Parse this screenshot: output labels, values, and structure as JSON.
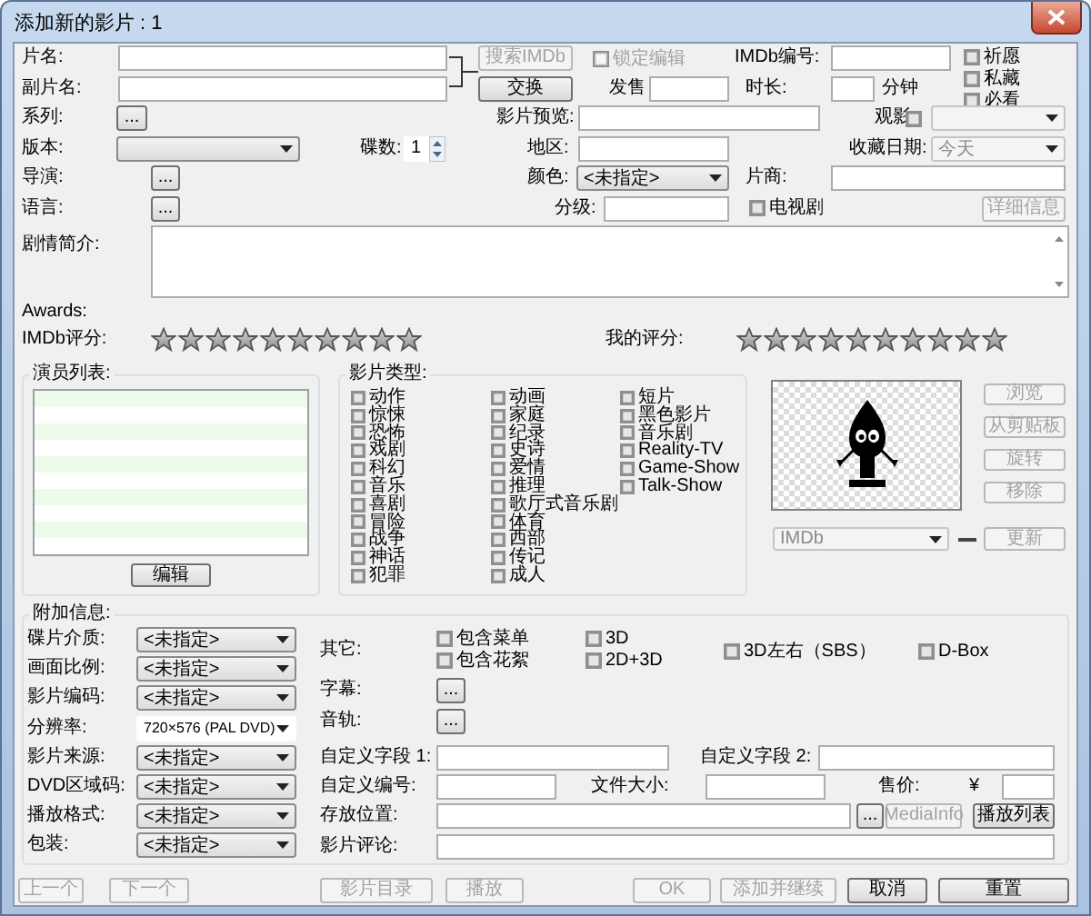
{
  "window": {
    "title": "添加新的影片 : 1"
  },
  "top_rows": [
    [
      {
        "kind": "label",
        "text": "片名:"
      },
      {
        "kind": "field"
      },
      {
        "kind": "button",
        "text": "搜索IMDb",
        "disabled": true
      },
      {
        "kind": "checkbox",
        "text": "锁定编辑",
        "checked": false,
        "disabled": true
      },
      {
        "kind": "label",
        "text": "IMDb编号:"
      },
      {
        "kind": "field"
      },
      {
        "kind": "stack",
        "items": [
          {
            "text": "祈愿",
            "checked": false,
            "disabled": false
          },
          {
            "text": "私藏",
            "checked": false,
            "disabled": false
          },
          {
            "text": "必看",
            "checked": false,
            "disabled": false
          }
        ]
      }
    ],
    [
      {
        "kind": "label",
        "text": "副片名:"
      },
      {
        "kind": "field"
      },
      {
        "kind": "button",
        "text": "交换",
        "disabled": false
      },
      {
        "kind": "label",
        "text": "发售"
      },
      {
        "kind": "field"
      },
      {
        "kind": "label",
        "text": "时长:"
      },
      {
        "kind": "field"
      },
      {
        "kind": "label",
        "text": "分钟"
      }
    ],
    [
      {
        "kind": "label",
        "text": "系列:"
      },
      {
        "kind": "button",
        "text": "...",
        "disabled": false
      },
      {
        "kind": "label",
        "text": "影片预览:"
      },
      {
        "kind": "field"
      },
      {
        "kind": "label",
        "text": "观影"
      },
      {
        "kind": "checkbox",
        "checked": false,
        "disabled": false
      },
      {
        "kind": "dropdown",
        "disabled": true
      }
    ],
    [
      {
        "kind": "label",
        "text": "版本:"
      },
      {
        "kind": "dropdown",
        "disabled": false
      },
      {
        "kind": "label",
        "text": "碟数:"
      },
      {
        "kind": "spin",
        "value": "1"
      },
      {
        "kind": "label",
        "text": "地区:"
      },
      {
        "kind": "field"
      },
      {
        "kind": "label",
        "text": "收藏日期:"
      },
      {
        "kind": "dropdown",
        "value": "今天",
        "disabled": true
      }
    ],
    [
      {
        "kind": "label",
        "text": "导演:"
      },
      {
        "kind": "button",
        "text": "...",
        "disabled": false
      },
      {
        "kind": "label",
        "text": "颜色:"
      },
      {
        "kind": "dropdown",
        "value": "<未指定>",
        "disabled": false
      },
      {
        "kind": "label",
        "text": "片商:"
      },
      {
        "kind": "field"
      }
    ],
    [
      {
        "kind": "label",
        "text": "语言:"
      },
      {
        "kind": "button",
        "text": "...",
        "disabled": false
      },
      {
        "kind": "label",
        "text": "分级:"
      },
      {
        "kind": "field"
      },
      {
        "kind": "checkbox",
        "text": "电视剧",
        "checked": false,
        "disabled": false
      },
      {
        "kind": "button",
        "text": "详细信息",
        "disabled": true
      }
    ]
  ],
  "synopsis": {
    "label": "剧情简介:"
  },
  "awards_label": "Awards:",
  "rating_row": [
    {
      "kind": "label",
      "text": "IMDb评分:"
    },
    {
      "kind": "stars",
      "stars": 0
    },
    {
      "kind": "label",
      "text": "我的评分:"
    },
    {
      "kind": "stars",
      "stars": 0
    }
  ],
  "cast": {
    "title": "演员列表:",
    "button": {
      "text": "编辑",
      "disabled": false
    }
  },
  "genres": {
    "title": "影片类型:",
    "columns": [
      [
        {
          "text": "动作",
          "checked": false
        },
        {
          "text": "惊悚",
          "checked": false
        },
        {
          "text": "恐怖",
          "checked": false
        },
        {
          "text": "戏剧",
          "checked": false
        },
        {
          "text": "科幻",
          "checked": false
        },
        {
          "text": "音乐",
          "checked": false
        },
        {
          "text": "喜剧",
          "checked": false
        },
        {
          "text": "冒险",
          "checked": false
        },
        {
          "text": "战争",
          "checked": false
        },
        {
          "text": "神话",
          "checked": false
        },
        {
          "text": "犯罪",
          "checked": false
        }
      ],
      [
        {
          "text": "动画",
          "checked": false
        },
        {
          "text": "家庭",
          "checked": false
        },
        {
          "text": "纪录",
          "checked": false
        },
        {
          "text": "史诗",
          "checked": false
        },
        {
          "text": "爱情",
          "checked": false
        },
        {
          "text": "推理",
          "checked": false
        },
        {
          "text": "歌厅式音乐剧",
          "checked": false
        },
        {
          "text": "体育",
          "checked": false
        },
        {
          "text": "西部",
          "checked": false
        },
        {
          "text": "传记",
          "checked": false
        },
        {
          "text": "成人",
          "checked": false
        }
      ],
      [
        {
          "text": "短片",
          "checked": false
        },
        {
          "text": "黑色影片",
          "checked": false
        },
        {
          "text": "音乐剧",
          "checked": false
        },
        {
          "text": "Reality-TV",
          "checked": false
        },
        {
          "text": "Game-Show",
          "checked": false
        },
        {
          "text": "Talk-Show",
          "checked": false
        }
      ]
    ]
  },
  "cover": {
    "buttons": [
      {
        "text": "浏览",
        "disabled": true
      },
      {
        "text": "从剪贴板",
        "disabled": true
      },
      {
        "text": "旋转",
        "disabled": true
      },
      {
        "text": "移除",
        "disabled": true
      }
    ],
    "source": {
      "value": "IMDb",
      "disabled": true
    },
    "update_button": {
      "text": "更新",
      "disabled": true
    }
  },
  "extra_info": {
    "title": "附加信息:",
    "left_rows": [
      [
        {
          "kind": "label",
          "text": "碟片介质:"
        },
        {
          "kind": "dropdown",
          "value": "<未指定>",
          "disabled": false
        }
      ],
      [
        {
          "kind": "label",
          "text": "画面比例:"
        },
        {
          "kind": "dropdown",
          "value": "<未指定>",
          "disabled": false
        }
      ],
      [
        {
          "kind": "label",
          "text": "影片编码:"
        },
        {
          "kind": "dropdown",
          "value": "<未指定>",
          "disabled": false
        }
      ],
      [
        {
          "kind": "label",
          "text": "分辨率:"
        },
        {
          "kind": "combo",
          "value": "720×576 (PAL DVD)",
          "disabled": false
        }
      ],
      [
        {
          "kind": "label",
          "text": "影片来源:"
        },
        {
          "kind": "dropdown",
          "value": "<未指定>",
          "disabled": false
        }
      ],
      [
        {
          "kind": "label",
          "text": "DVD区域码:"
        },
        {
          "kind": "dropdown",
          "value": "<未指定>",
          "disabled": false
        }
      ],
      [
        {
          "kind": "label",
          "text": "播放格式:"
        },
        {
          "kind": "dropdown",
          "value": "<未指定>",
          "disabled": false
        }
      ],
      [
        {
          "kind": "label",
          "text": "包装:"
        },
        {
          "kind": "dropdown",
          "value": "<未指定>",
          "disabled": false
        }
      ]
    ],
    "right_rows": [
      [
        {
          "kind": "label",
          "text": "其它:"
        },
        {
          "kind": "stack",
          "items": [
            {
              "text": "包含菜单",
              "checked": false,
              "disabled": false
            },
            {
              "text": "包含花絮",
              "checked": false,
              "disabled": false
            }
          ]
        },
        {
          "kind": "stack",
          "items": [
            {
              "text": "3D",
              "checked": false,
              "disabled": false
            },
            {
              "text": "2D+3D",
              "checked": false,
              "disabled": false
            }
          ]
        },
        {
          "kind": "checkbox",
          "text": "3D左右（SBS）",
          "checked": false,
          "disabled": false
        },
        {
          "kind": "checkbox",
          "text": "D-Box",
          "checked": false,
          "disabled": false
        }
      ],
      [
        {
          "kind": "label",
          "text": "字幕:"
        },
        {
          "kind": "button",
          "text": "...",
          "disabled": false
        }
      ],
      [
        {
          "kind": "label",
          "text": "音轨:"
        },
        {
          "kind": "button",
          "text": "...",
          "disabled": false
        }
      ],
      [
        {
          "kind": "label",
          "text": "自定义字段 1:"
        },
        {
          "kind": "field"
        },
        {
          "kind": "label",
          "text": "自定义字段 2:"
        },
        {
          "kind": "field"
        }
      ],
      [
        {
          "kind": "label",
          "text": "自定义编号:"
        },
        {
          "kind": "field"
        },
        {
          "kind": "label",
          "text": "文件大小:"
        },
        {
          "kind": "field"
        },
        {
          "kind": "label",
          "text": "售价:"
        },
        {
          "kind": "label",
          "text": "¥"
        },
        {
          "kind": "field"
        }
      ],
      [
        {
          "kind": "label",
          "text": "存放位置:"
        },
        {
          "kind": "field"
        },
        {
          "kind": "button",
          "text": "...",
          "disabled": false
        },
        {
          "kind": "button",
          "text": "MediaInfo",
          "disabled": true
        },
        {
          "kind": "button",
          "text": "播放列表",
          "disabled": false
        }
      ],
      [
        {
          "kind": "label",
          "text": "影片评论:"
        },
        {
          "kind": "field"
        }
      ]
    ]
  },
  "bottom_buttons": [
    {
      "text": "上一个",
      "disabled": true
    },
    {
      "text": "下一个",
      "disabled": true
    },
    {
      "text": "影片目录",
      "disabled": true
    },
    {
      "text": "播放",
      "disabled": true
    },
    {
      "text": "OK",
      "disabled": true
    },
    {
      "text": "添加并继续",
      "disabled": true
    },
    {
      "text": "取消",
      "disabled": false
    },
    {
      "text": "重置",
      "disabled": false
    }
  ]
}
